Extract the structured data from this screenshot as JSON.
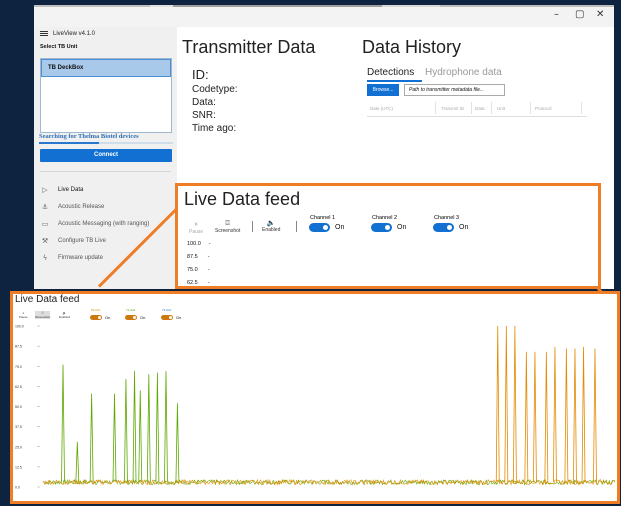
{
  "app": {
    "title": "LiveView v4.1.0",
    "window_controls": [
      "–",
      "▢",
      "✕"
    ]
  },
  "sidebar": {
    "select_label": "Select TB Unit",
    "units": [
      {
        "name": "TB DeckBox",
        "selected": true
      }
    ],
    "search_status": "Searching for Thelma Biotel devices",
    "connect_label": "Connect",
    "nav": [
      {
        "label": "Live Data",
        "icon": "play-outline-icon",
        "active": true
      },
      {
        "label": "Acoustic Release",
        "icon": "anchor-icon",
        "active": false
      },
      {
        "label": "Acoustic Messaging (with ranging)",
        "icon": "chat-icon",
        "active": false
      },
      {
        "label": "Configure TB Live",
        "icon": "wrench-icon",
        "active": false
      },
      {
        "label": "Firmware update",
        "icon": "bolt-icon",
        "active": false
      }
    ]
  },
  "transmitter": {
    "title": "Transmitter Data",
    "fields": {
      "id": "ID:",
      "codetype": "Codetype:",
      "data": "Data:",
      "snr": "SNR:",
      "time_ago": "Time ago:"
    }
  },
  "history": {
    "title": "Data History",
    "tabs": [
      {
        "label": "Detections",
        "active": true
      },
      {
        "label": "Hydrophone data",
        "active": false
      }
    ],
    "browse_label": "Browse...",
    "path_placeholder": "Path to transmitter metadata file...",
    "columns": [
      "Date (UTC)",
      "Transmit ID",
      "Data",
      "Unit",
      "Protocol"
    ]
  },
  "live_feed": {
    "title": "Live Data feed",
    "controls": {
      "pause": "Pause",
      "screenshot": "Screenshot",
      "sound": "Enabled"
    },
    "channels": [
      {
        "label": "Channel 1",
        "color": "#e38a00",
        "state": "On"
      },
      {
        "label": "Channel 2",
        "color": "#5fa800",
        "state": "On"
      },
      {
        "label": "Channel 3",
        "color": "#2c7bd0",
        "state": "On"
      }
    ],
    "y_ticks": [
      "100.0",
      "87.5",
      "75.0",
      "62.5"
    ],
    "y_values": [
      "-",
      "-",
      "-",
      "-"
    ]
  },
  "zoomed_feed": {
    "title": "Live Data feed",
    "controls": {
      "pause": "Pause",
      "screenshot": "Screenshot",
      "sound": "Enabled"
    },
    "channel_labels": [
      "69 kHz",
      "71 kHz",
      "73 kHz"
    ],
    "state": "On"
  },
  "chart_data": {
    "type": "line",
    "ylim": [
      0,
      100
    ],
    "y_ticks": [
      "100.0",
      "87.5",
      "75.0",
      "62.5",
      "50.0",
      "37.5",
      "25.0",
      "12.5",
      "0.0"
    ],
    "series": [
      {
        "color": "#5fa800",
        "baseline": 3,
        "pulses": [
          [
            0.035,
            76
          ],
          [
            0.06,
            28
          ],
          [
            0.085,
            58
          ],
          [
            0.125,
            58
          ],
          [
            0.145,
            67
          ],
          [
            0.16,
            72
          ],
          [
            0.17,
            60
          ],
          [
            0.185,
            70
          ],
          [
            0.2,
            71
          ],
          [
            0.215,
            72
          ],
          [
            0.235,
            52
          ]
        ]
      },
      {
        "color": "#e38a00",
        "baseline": 3,
        "pulses": [
          [
            0.795,
            100
          ],
          [
            0.81,
            100
          ],
          [
            0.825,
            100
          ],
          [
            0.845,
            84
          ],
          [
            0.86,
            84
          ],
          [
            0.88,
            84
          ],
          [
            0.895,
            87
          ],
          [
            0.915,
            86
          ],
          [
            0.93,
            86
          ],
          [
            0.945,
            87
          ],
          [
            0.965,
            86
          ]
        ]
      }
    ]
  }
}
